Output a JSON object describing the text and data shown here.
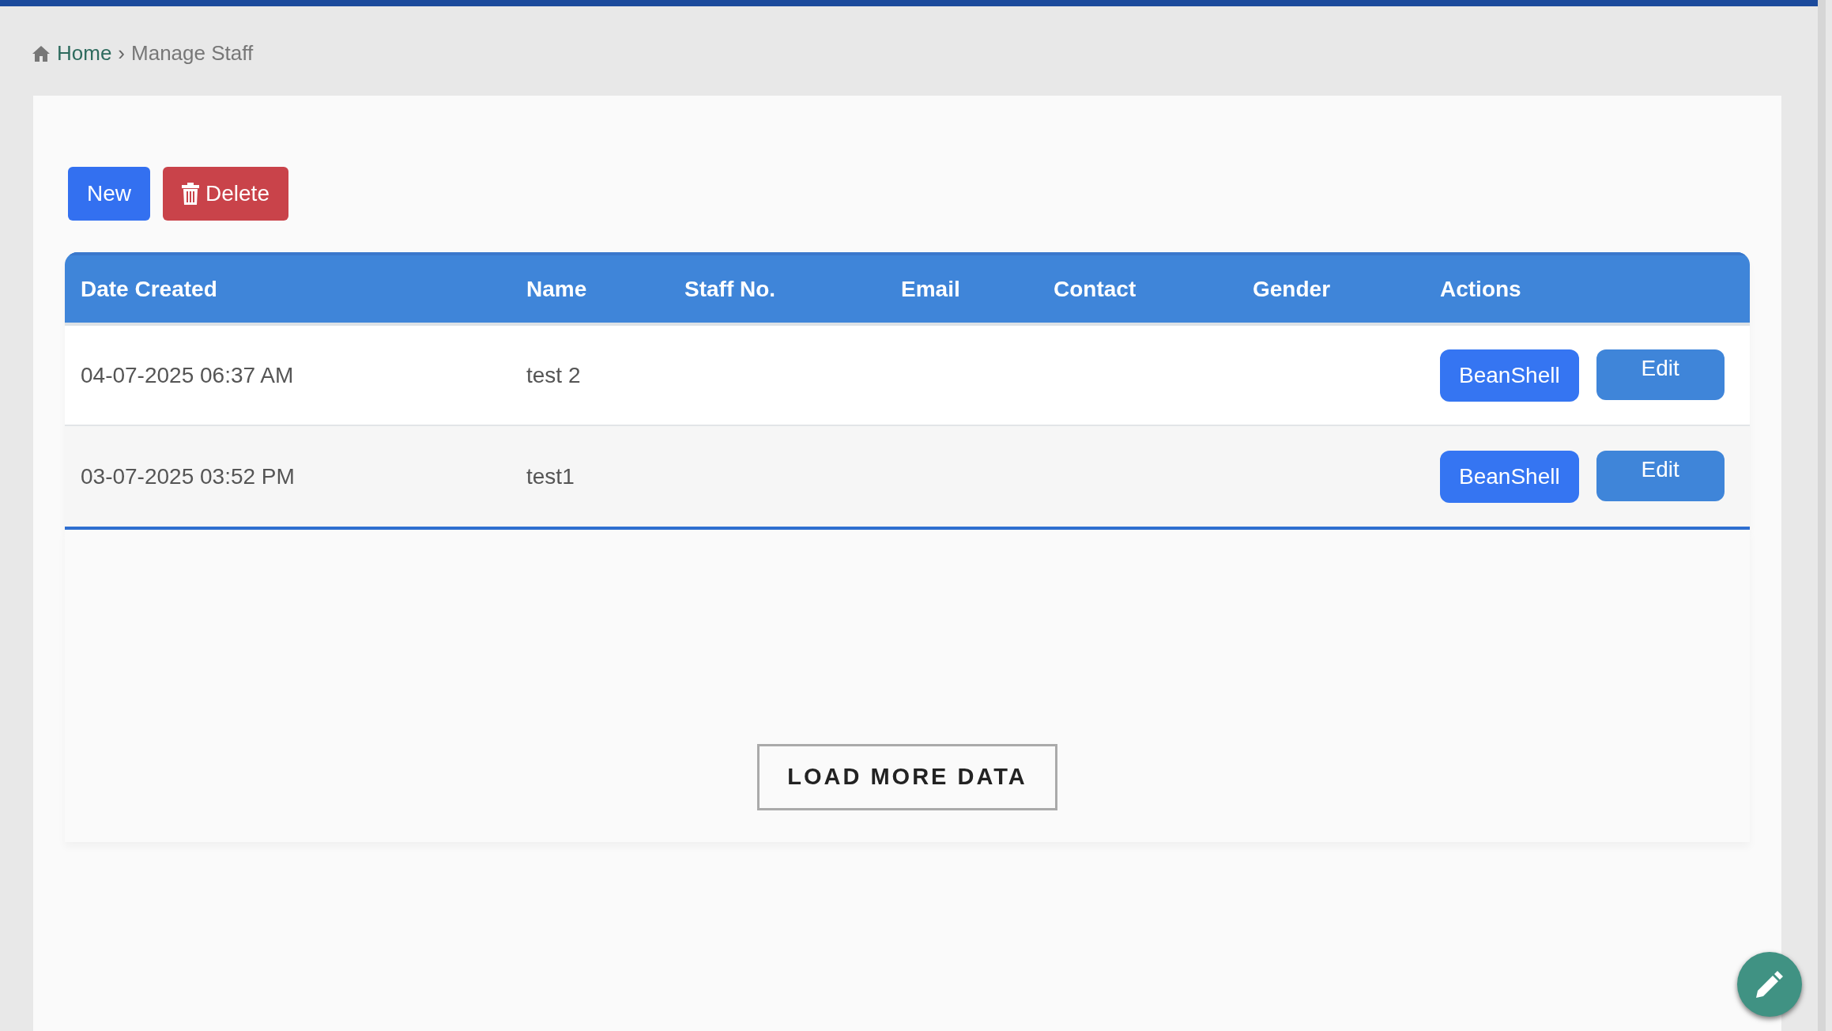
{
  "breadcrumb": {
    "home": "Home",
    "separator": "›",
    "current": "Manage Staff"
  },
  "toolbar": {
    "new": "New",
    "delete": "Delete"
  },
  "table": {
    "columns": [
      "Date Created",
      "Name",
      "Staff No.",
      "Email",
      "Contact",
      "Gender",
      "Actions"
    ],
    "rows": [
      {
        "date_created": "04-07-2025 06:37 AM",
        "name": "test 2",
        "actions": [
          "BeanShell",
          "Edit"
        ]
      },
      {
        "date_created": "03-07-2025 03:52 PM",
        "name": "test1",
        "actions": [
          "BeanShell",
          "Edit"
        ]
      }
    ]
  },
  "load_more": "LOAD MORE DATA"
}
